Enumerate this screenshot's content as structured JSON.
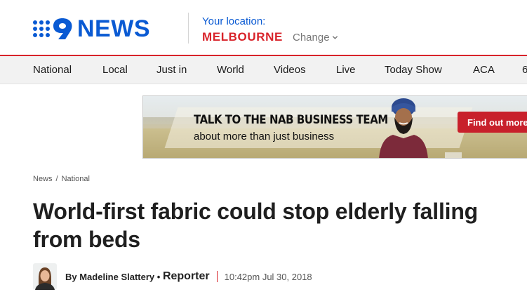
{
  "header": {
    "logo_text": "NEWS",
    "location_label": "Your location:",
    "location_city": "MELBOURNE",
    "change_label": "Change"
  },
  "nav": {
    "items": [
      {
        "label": "National"
      },
      {
        "label": "Local"
      },
      {
        "label": "Just in"
      },
      {
        "label": "World"
      },
      {
        "label": "Videos"
      },
      {
        "label": "Live"
      },
      {
        "label": "Today Show"
      },
      {
        "label": "ACA"
      },
      {
        "label": "6"
      }
    ]
  },
  "ad": {
    "headline": "TALK TO THE NAB BUSINESS TEAM",
    "subline": "about more than just business",
    "cta": "Find out more"
  },
  "breadcrumb": {
    "items": [
      "News",
      "National"
    ],
    "separator": "/"
  },
  "article": {
    "title": "World-first fabric could stop elderly falling from beds",
    "author": "By Madeline Slattery",
    "role": "Reporter",
    "date": "10:42pm Jul 30, 2018"
  },
  "colors": {
    "brand_blue": "#0a5ad3",
    "brand_red": "#d8232a",
    "nav_bg": "#f2f2f2"
  },
  "icons": [
    "nine-logo-icon",
    "chevron-down-icon",
    "avatar"
  ]
}
